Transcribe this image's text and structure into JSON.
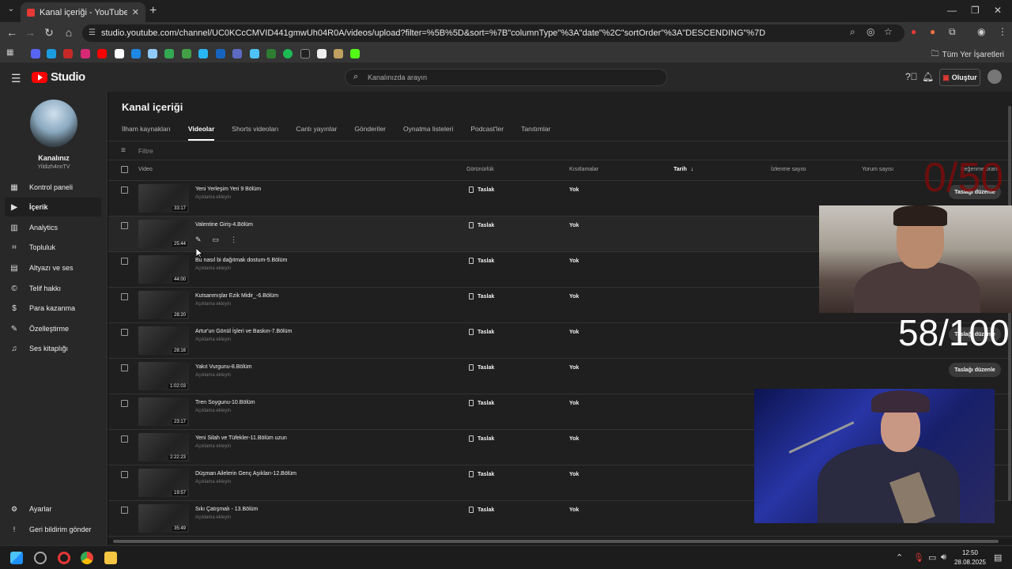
{
  "browser": {
    "tab_title": "Kanal içeriği - YouTube Studio",
    "url": "studio.youtube.com/channel/UC0KCcCMVID441gmwUh04R0A/videos/upload?filter=%5B%5D&sort=%7B\"columnType\"%3A\"date\"%2C\"sortOrder\"%3A\"DESCENDING\"%7D",
    "bookmarks_folder": "Tüm Yer İşaretleri"
  },
  "header": {
    "logo_text": "Studio",
    "search_placeholder": "Kanalınızda arayın",
    "create_label": "Oluştur"
  },
  "sidebar": {
    "channel_name": "Kanalınız",
    "channel_handle": "Yildizh4nnTV",
    "items": [
      {
        "label": "Kontrol paneli",
        "icon": "dashboard-icon"
      },
      {
        "label": "İçerik",
        "icon": "content-icon"
      },
      {
        "label": "Analytics",
        "icon": "analytics-icon"
      },
      {
        "label": "Topluluk",
        "icon": "community-icon"
      },
      {
        "label": "Altyazı ve ses",
        "icon": "subtitles-icon"
      },
      {
        "label": "Telif hakkı",
        "icon": "copyright-icon"
      },
      {
        "label": "Para kazanma",
        "icon": "dollar-icon"
      },
      {
        "label": "Özelleştirme",
        "icon": "customize-icon"
      },
      {
        "label": "Ses kitaplığı",
        "icon": "audio-library-icon"
      }
    ],
    "bottom": [
      {
        "label": "Ayarlar",
        "icon": "gear-icon"
      },
      {
        "label": "Geri bildirim gönder",
        "icon": "feedback-icon"
      }
    ]
  },
  "main": {
    "title": "Kanal içeriği",
    "tabs": [
      "İlham kaynakları",
      "Videolar",
      "Shorts videoları",
      "Canlı yayınlar",
      "Gönderiler",
      "Oynatma listeleri",
      "Podcast'ler",
      "Tanıtımlar"
    ],
    "active_tab": "Videolar",
    "filter_placeholder": "Filtre",
    "columns": {
      "video": "Video",
      "visibility": "Görünürlük",
      "restrictions": "Kısıtlamalar",
      "date": "Tarih",
      "views": "İzlenme sayısı",
      "comments": "Yorum sayısı",
      "likes": "Beğenme oranı"
    },
    "draft_label": "Taslağı düzenle",
    "add_desc": "Açıklama ekleyin",
    "rows": [
      {
        "title": "Yeni Yerleşim Yeri 9 Bölüm",
        "duration": "33:17",
        "visibility": "Taslak",
        "restriction": "Yok"
      },
      {
        "title": "Valentine Giriş-4.Bölüm",
        "duration": "25:44",
        "visibility": "Taslak",
        "restriction": "Yok"
      },
      {
        "title": "Bu nasıl bi dağıtmak dostum-5.Bölüm",
        "duration": "44:00",
        "visibility": "Taslak",
        "restriction": "Yok"
      },
      {
        "title": "Kutsanmışlar Ezik Midir_-6.Bölüm",
        "duration": "28:20",
        "visibility": "Taslak",
        "restriction": "Yok"
      },
      {
        "title": "Artur'un Gönül İşleri ve Baskın-7.Bölüm",
        "duration": "28:16",
        "visibility": "Taslak",
        "restriction": "Yok"
      },
      {
        "title": "Yakıt Vurgunu-8.Bölüm",
        "duration": "1:02:03",
        "visibility": "Taslak",
        "restriction": "Yok"
      },
      {
        "title": "Tren Soygunu-10.Bölüm",
        "duration": "23:17",
        "visibility": "Taslak",
        "restriction": "Yok"
      },
      {
        "title": "Yeni Silah ve Tüfekler-11.Bölüm uzun",
        "duration": "2:22:23",
        "visibility": "Taslak",
        "restriction": "Yok"
      },
      {
        "title": "Düşman Ailelerin Genç Aşıkları-12.Bölüm",
        "duration": "19:57",
        "visibility": "Taslak",
        "restriction": "Yok"
      },
      {
        "title": "Sıkı Çatışmalı - 13.Bölüm",
        "duration": "35:49",
        "visibility": "Taslak",
        "restriction": "Yok"
      }
    ]
  },
  "overlays": {
    "counter_top": "0/50",
    "counter_main": "58/100"
  },
  "taskbar": {
    "time": "12:50",
    "date": "28.08.2025"
  }
}
